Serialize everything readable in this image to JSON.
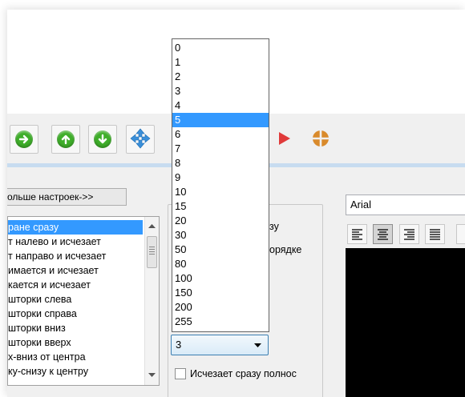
{
  "toolbar": {
    "buttons": [
      {
        "icon": "arrow-right-icon"
      },
      {
        "icon": "arrow-up-icon"
      },
      {
        "icon": "arrow-down-icon"
      },
      {
        "icon": "move-icon"
      },
      {
        "icon": "play-icon"
      },
      {
        "icon": "stop-icon"
      }
    ],
    "colors": {
      "green": "#3fae2a",
      "blue": "#3a8fd9",
      "red": "#e03a3a",
      "orange": "#d98a2b"
    }
  },
  "more_settings_button": "ольше настроек->>",
  "effects_list": {
    "items": [
      "ране сразу",
      "т налево и исчезает",
      "т направо и исчезает",
      "имается и исчезает",
      "кается и исчезает",
      " шторки слева",
      " шторки справа",
      " шторки вниз",
      " шторки вверх",
      "х-вниз от центра",
      "ку-снизу к центру"
    ],
    "selected_index": 0
  },
  "options": {
    "label_top": "зу",
    "label_order": "орядке",
    "checkbox_label": "Исчезает сразу полнос"
  },
  "speed_combo": {
    "value": "3",
    "options": [
      "0",
      "1",
      "2",
      "3",
      "4",
      "5",
      "6",
      "7",
      "8",
      "9",
      "10",
      "15",
      "20",
      "30",
      "50",
      "80",
      "100",
      "150",
      "200",
      "255"
    ],
    "highlighted_index": 5
  },
  "font_panel": {
    "font_name": "Arial",
    "align_icons": [
      "align-left-icon",
      "align-center-icon",
      "align-right-icon",
      "align-justify-icon"
    ],
    "active_align_index": 1
  }
}
